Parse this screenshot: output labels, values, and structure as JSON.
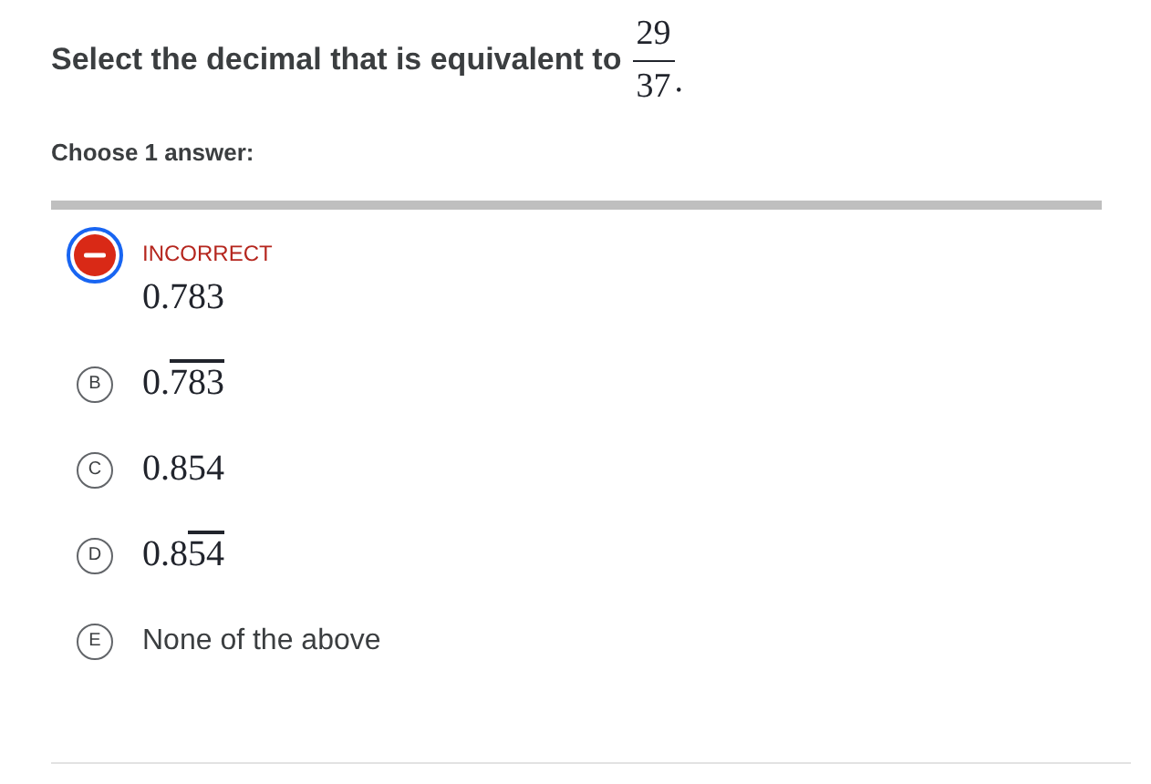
{
  "question": {
    "text": "Select the decimal that is equivalent to",
    "numerator": "29",
    "denominator": "37",
    "end": "."
  },
  "instruction": "Choose 1 answer:",
  "choices": [
    {
      "kind": "math",
      "value": "0.783",
      "selected": true,
      "incorrect": true,
      "status_label": "INCORRECT"
    },
    {
      "letter": "B",
      "kind": "math",
      "value": "0.",
      "repeating": "783",
      "selected": false
    },
    {
      "letter": "C",
      "kind": "math",
      "value": "0.854",
      "selected": false
    },
    {
      "letter": "D",
      "kind": "math",
      "value": "0.8",
      "repeating": "54",
      "selected": false
    },
    {
      "letter": "E",
      "kind": "text",
      "value": "None of the above",
      "selected": false
    }
  ]
}
